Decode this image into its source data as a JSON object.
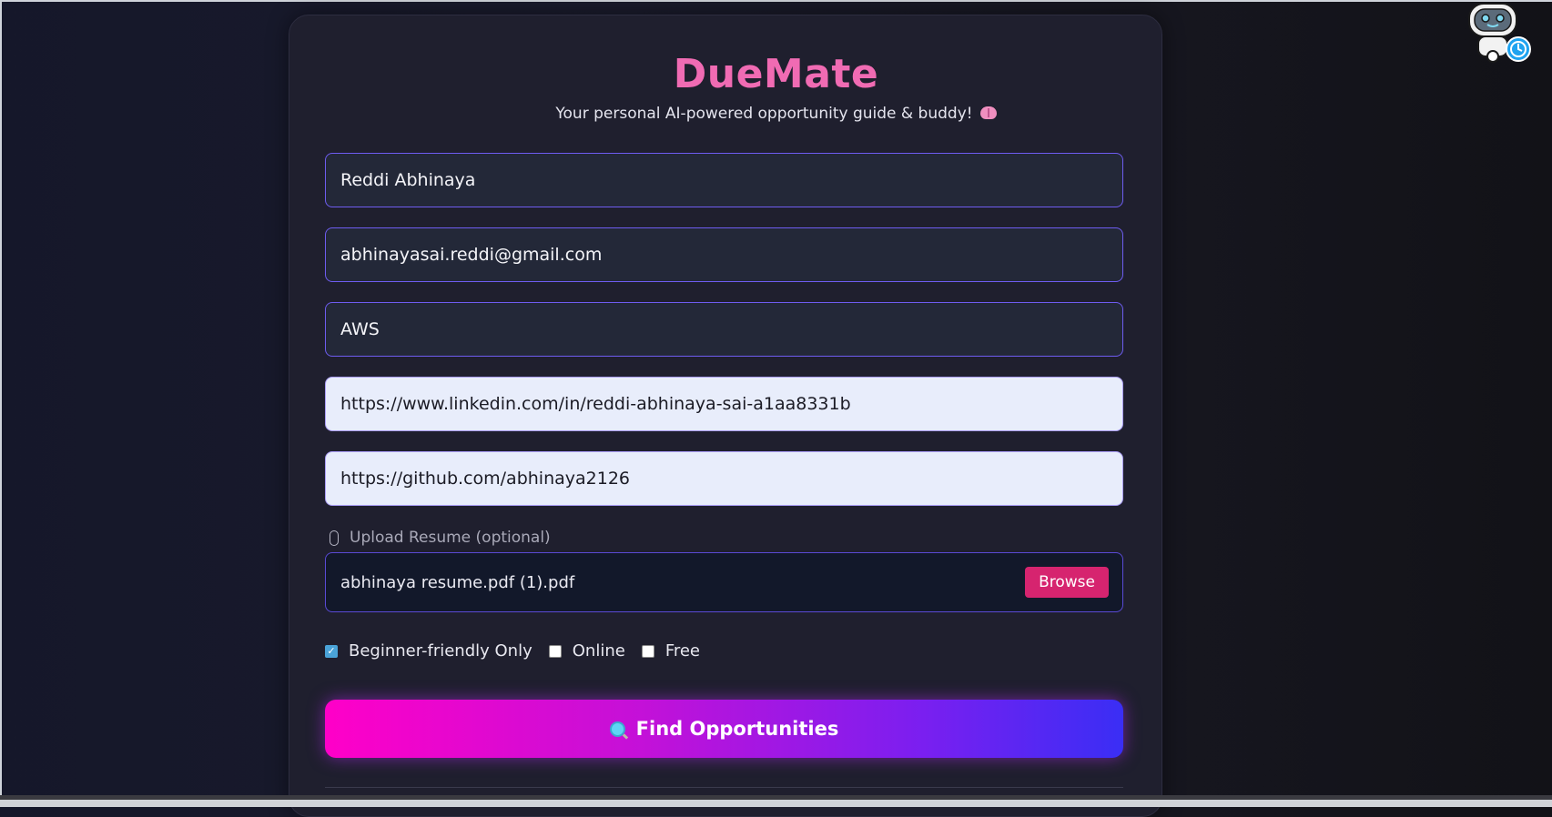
{
  "app": {
    "title": "DueMate",
    "subtitle": "Your personal AI-powered opportunity guide & buddy!"
  },
  "form": {
    "name_value": "Reddi Abhinaya",
    "email_value": "abhinayasai.reddi@gmail.com",
    "interest_value": "AWS",
    "linkedin_value": "https://www.linkedin.com/in/reddi-abhinaya-sai-a1aa8331b",
    "github_value": "https://github.com/abhinaya2126",
    "upload_label": "Upload Resume (optional)",
    "file_name": "abhinaya resume.pdf (1).pdf",
    "browse_label": "Browse",
    "filters": [
      {
        "label": "Beginner-friendly Only",
        "checked": true
      },
      {
        "label": "Online",
        "checked": false
      },
      {
        "label": "Free",
        "checked": false
      }
    ],
    "submit_label": "Find Opportunities"
  },
  "colors": {
    "title": "#f06bb3",
    "browse_button": "#d6246f",
    "gradient_start": "#ff00c8",
    "gradient_end": "#3a2ef5"
  },
  "icons": [
    "brain-icon",
    "paperclip-icon",
    "magnifier-icon",
    "robot-assistant-icon"
  ]
}
